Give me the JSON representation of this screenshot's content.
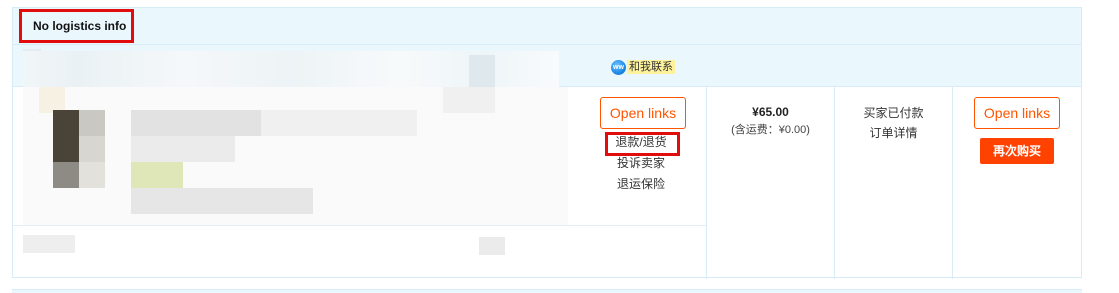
{
  "order": {
    "logistics_label": "No logistics info",
    "shop": {
      "contact_icon_text": "ww",
      "contact_label": "和我联系"
    },
    "item": {
      "open_links_label": "Open links",
      "ops": {
        "refund_label": "退款/退货",
        "complain_label": "投诉卖家",
        "insurance_label": "退运保险"
      }
    },
    "price": {
      "amount": "¥65.00",
      "shipping": "(含运费：¥0.00)"
    },
    "status": {
      "text": "买家已付款",
      "detail_link": "订单详情"
    },
    "actions": {
      "open_links_label": "Open links",
      "rebuy_label": "再次购买"
    }
  },
  "colors": {
    "accent": "#ff5500",
    "rebuy_bg": "#ff4200",
    "highlight_border": "#e10d0d",
    "header_bg": "#eaf8fe"
  }
}
